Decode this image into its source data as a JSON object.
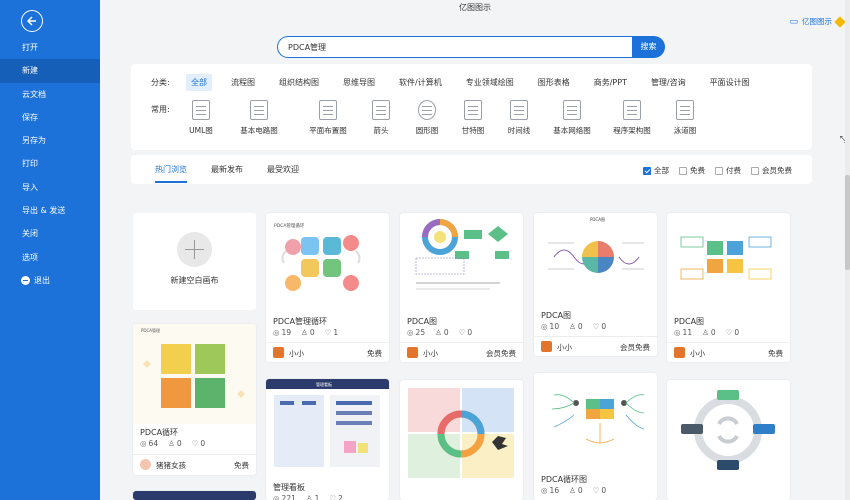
{
  "window": {
    "title": "亿图图示"
  },
  "top_right": {
    "label": "亿图图示"
  },
  "sidebar": {
    "items": [
      {
        "label": "打开"
      },
      {
        "label": "新建"
      },
      {
        "label": "云文档"
      },
      {
        "label": "保存"
      },
      {
        "label": "另存为"
      },
      {
        "label": "打印"
      },
      {
        "label": "导入"
      },
      {
        "label": "导出 & 发送"
      },
      {
        "label": "关闭"
      },
      {
        "label": "选项"
      },
      {
        "label": "退出"
      }
    ],
    "active_index": 1
  },
  "search": {
    "value": "PDCA管理",
    "button_label": "搜索"
  },
  "categories": {
    "label": "分类:",
    "items": [
      "全部",
      "流程图",
      "组织结构图",
      "思维导图",
      "软件/计算机",
      "专业领域绘图",
      "图形表格",
      "商务/PPT",
      "管理/咨询",
      "平面设计图"
    ],
    "active_index": 0
  },
  "common": {
    "label": "常用:",
    "items": [
      "UML图",
      "基本电路图",
      "平面布置图",
      "箭头",
      "圆形图",
      "甘特图",
      "时间线",
      "基本网络图",
      "程序架构图",
      "泳道图"
    ]
  },
  "tabs": {
    "items": [
      "热门浏览",
      "最新发布",
      "最受欢迎"
    ],
    "active_index": 0
  },
  "filters": [
    {
      "label": "全部",
      "checked": true
    },
    {
      "label": "免费",
      "checked": false
    },
    {
      "label": "付费",
      "checked": false
    },
    {
      "label": "会员免费",
      "checked": false
    }
  ],
  "new_blank": {
    "label": "新建空白画布"
  },
  "cards": [
    {
      "title": "PDCA管理循环",
      "views": "19",
      "likes": "0",
      "favs": "1",
      "author": "小小",
      "price": "免费"
    },
    {
      "title": "PDCA图",
      "views": "25",
      "likes": "0",
      "favs": "0",
      "author": "小小",
      "price": "会员免费"
    },
    {
      "title": "PDCA图",
      "views": "10",
      "likes": "0",
      "favs": "0",
      "author": "小小",
      "price": "会员免费"
    },
    {
      "title": "PDCA图",
      "views": "11",
      "likes": "0",
      "favs": "0",
      "author": "小小",
      "price": "免费"
    },
    {
      "title": "PDCA循环",
      "views": "64",
      "likes": "0",
      "favs": "0",
      "author": "猪猪女孩",
      "price": "免费"
    },
    {
      "title": "管理看板",
      "views": "221",
      "likes": "1",
      "favs": "2",
      "author": "",
      "price": ""
    },
    {
      "title": "PDCA循环图",
      "views": "16",
      "likes": "0",
      "favs": "0",
      "author": "",
      "price": ""
    }
  ],
  "thumb_texts": {
    "card1": "PDCA管理循环",
    "card3": "PDCA图",
    "card5": "PDCA管理",
    "card6": "管理看板"
  }
}
